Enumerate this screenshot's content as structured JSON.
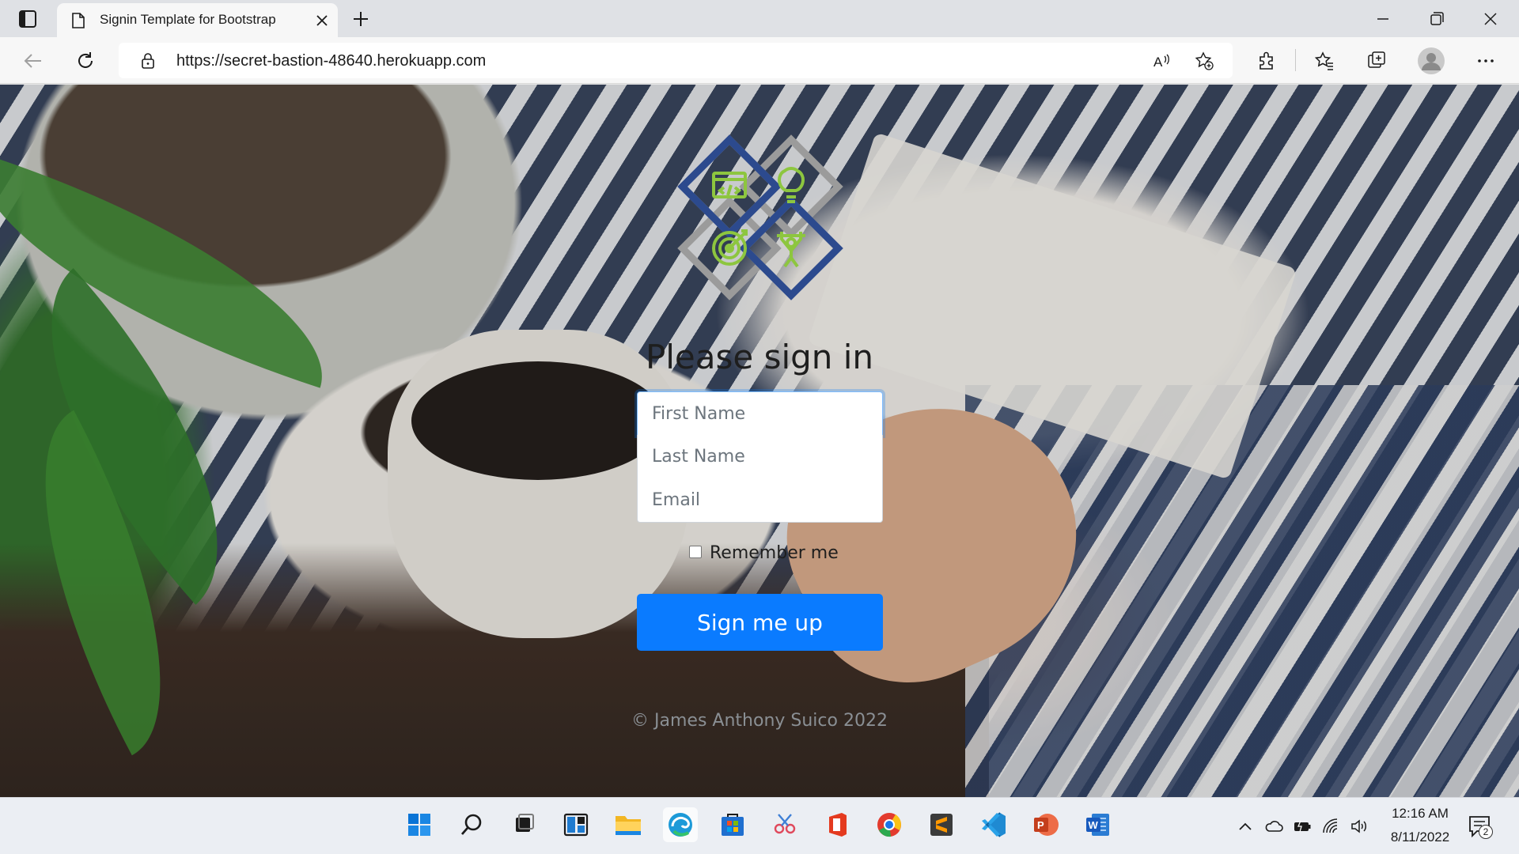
{
  "browser": {
    "tab_title": "Signin Template for Bootstrap",
    "url": "https://secret-bastion-48640.herokuapp.com"
  },
  "form": {
    "heading": "Please sign in",
    "first_name_placeholder": "First Name",
    "last_name_placeholder": "Last Name",
    "email_placeholder": "Email",
    "remember_label": "Remember me",
    "submit_label": "Sign me up",
    "footer": "© James Anthony Suico 2022"
  },
  "colors": {
    "primary_button": "#0a7bff",
    "logo_blue": "#2c4a8e",
    "logo_gray": "#9b9b9b",
    "logo_green": "#8dc63f"
  },
  "taskbar": {
    "apps": [
      "start-icon",
      "search-icon",
      "task-view-icon",
      "widgets-icon",
      "file-explorer-icon",
      "edge-icon",
      "store-icon",
      "snipping-tool-icon",
      "office-icon",
      "chrome-icon",
      "sublime-text-icon",
      "vscode-icon",
      "powerpoint-icon",
      "word-icon"
    ],
    "time": "12:16 AM",
    "date": "8/11/2022",
    "notification_count": "2"
  }
}
